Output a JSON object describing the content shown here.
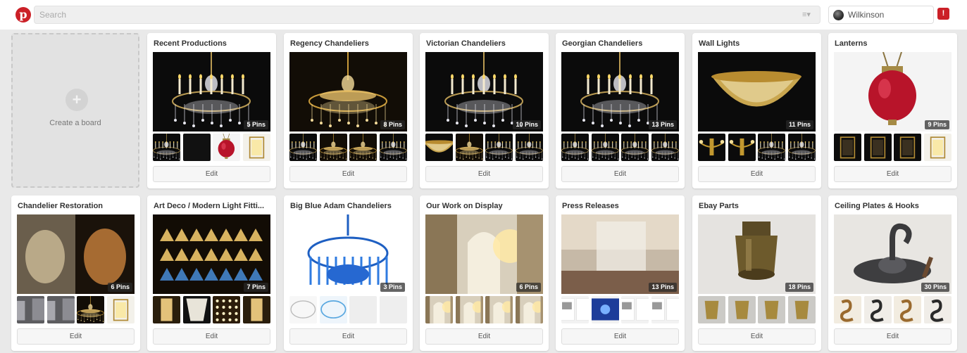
{
  "header": {
    "search_placeholder": "Search",
    "user_name": "Wilkinson",
    "notification_count": "!"
  },
  "create_board": {
    "label": "Create a board"
  },
  "edit_label": "Edit",
  "boards": [
    {
      "title": "Recent Productions",
      "pins": "5 Pins",
      "cover": "chandelier-dark",
      "thumbs": [
        "chandelier-dark",
        "dark",
        "red-lantern",
        "lantern-light"
      ]
    },
    {
      "title": "Regency Chandeliers",
      "pins": "8 Pins",
      "cover": "gold-chandelier",
      "thumbs": [
        "chandelier-dark",
        "gold-chandelier",
        "gold-chandelier",
        "chandelier-dark"
      ]
    },
    {
      "title": "Victorian Chandeliers",
      "pins": "10 Pins",
      "cover": "chandelier-dark",
      "thumbs": [
        "bowl",
        "gold-chandelier",
        "chandelier-dark",
        "chandelier-dark"
      ]
    },
    {
      "title": "Georgian Chandeliers",
      "pins": "13 Pins",
      "cover": "chandelier-dark",
      "thumbs": [
        "chandelier-dark",
        "chandelier-dark",
        "chandelier-dark",
        "chandelier-dark"
      ]
    },
    {
      "title": "Wall Lights",
      "pins": "11 Pins",
      "cover": "bowl",
      "thumbs": [
        "wall-light",
        "wall-light",
        "chandelier-dark",
        "chandelier-dark"
      ]
    },
    {
      "title": "Lanterns",
      "pins": "9 Pins",
      "cover": "red-lantern",
      "thumbs": [
        "lantern-dark",
        "lantern-dark",
        "lantern-dark",
        "lantern-light"
      ]
    },
    {
      "title": "Chandelier Restoration",
      "pins": "6 Pins",
      "cover": "restoration",
      "thumbs": [
        "workshop",
        "workshop",
        "gold-chandelier",
        "lantern-light"
      ]
    },
    {
      "title": "Art Deco / Modern Light Fitti...",
      "pins": "7 Pins",
      "cover": "art-deco",
      "thumbs": [
        "deco-gold",
        "deco-shade",
        "deco-dots",
        "deco-gold"
      ]
    },
    {
      "title": "Big Blue Adam Chandeliers",
      "pins": "3 Pins",
      "cover": "blue-chandelier",
      "thumbs": [
        "sketch",
        "blue-sketch",
        "empty",
        "empty"
      ]
    },
    {
      "title": "Our Work on Display",
      "pins": "6 Pins",
      "cover": "interior",
      "thumbs": [
        "interior",
        "interior",
        "interior",
        "interior"
      ]
    },
    {
      "title": "Press Releases",
      "pins": "13 Pins",
      "cover": "press",
      "thumbs": [
        "magazine",
        "magazine-blue",
        "magazine",
        "magazine"
      ]
    },
    {
      "title": "Ebay Parts",
      "pins": "18 Pins",
      "cover": "lampholder",
      "thumbs": [
        "brass-part",
        "brass-part",
        "brass-part",
        "brass-part"
      ]
    },
    {
      "title": "Ceiling Plates & Hooks",
      "pins": "30 Pins",
      "cover": "hook",
      "thumbs": [
        "s-hook",
        "s-hook-dark",
        "s-hook",
        "s-hook-dark"
      ]
    }
  ],
  "colors": {
    "brand_red": "#cb2027",
    "page_bg": "#e9e9e9",
    "card_bg": "#ffffff"
  }
}
